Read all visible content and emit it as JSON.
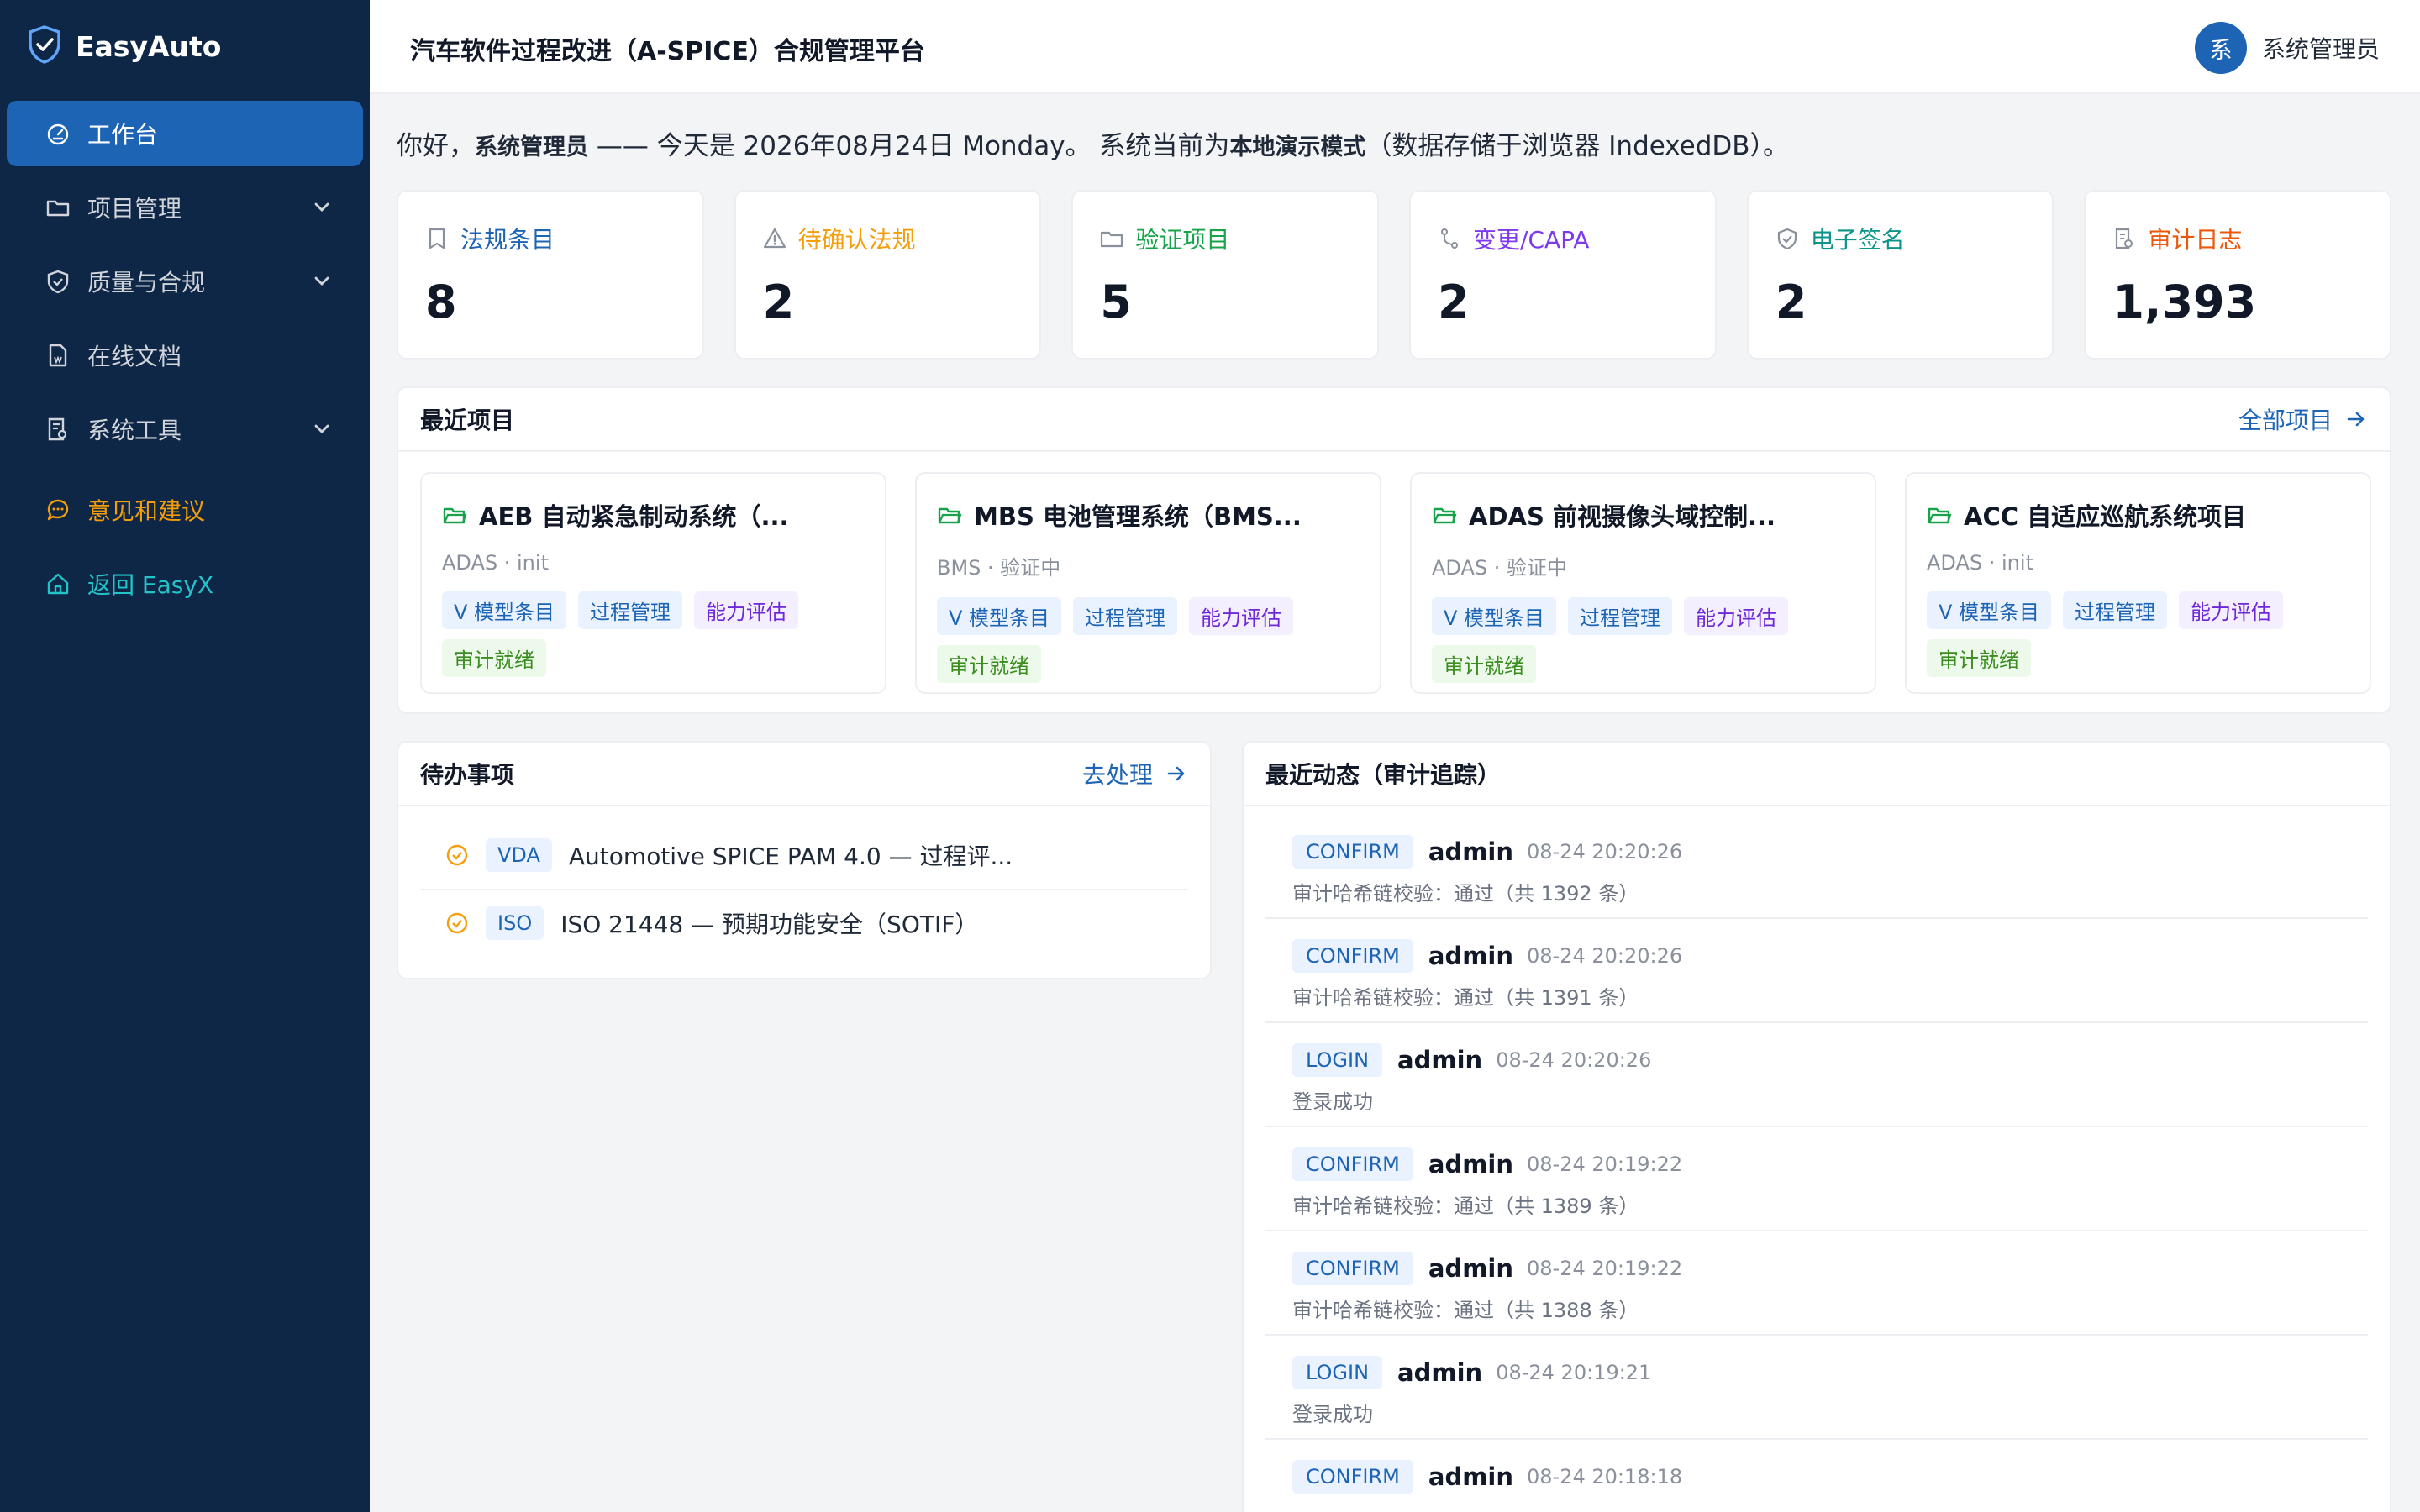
{
  "brand": {
    "name": "EasyAuto"
  },
  "sidebar": {
    "items": [
      {
        "label": "工作台",
        "icon": "dashboard-icon",
        "active": true
      },
      {
        "label": "项目管理",
        "icon": "folder-icon",
        "expandable": true
      },
      {
        "label": "质量与合规",
        "icon": "shield-icon",
        "expandable": true
      },
      {
        "label": "在线文档",
        "icon": "document-icon"
      },
      {
        "label": "系统工具",
        "icon": "tools-icon",
        "expandable": true
      }
    ],
    "feedback": {
      "label": "意见和建议",
      "icon": "chat-icon",
      "color": "#f59e0b"
    },
    "back": {
      "label": "返回 EasyX",
      "icon": "home-icon",
      "color": "#22c3c9"
    }
  },
  "header": {
    "title": "汽车软件过程改进（A-SPICE）合规管理平台",
    "avatar": "系",
    "username": "系统管理员"
  },
  "greeting": {
    "hello": "你好，",
    "user": "系统管理员",
    "mid": " —— 今天是 2026年08月24日 Monday。 系统当前为",
    "mode": "本地演示模式",
    "tail": "（数据存储于浏览器 IndexedDB）。"
  },
  "stats": [
    {
      "label": "法规条目",
      "value": "8",
      "color": "#1d64b5",
      "icon": "bookmark-icon"
    },
    {
      "label": "待确认法规",
      "value": "2",
      "color": "#f59e0b",
      "icon": "warning-icon"
    },
    {
      "label": "验证项目",
      "value": "5",
      "color": "#16a34a",
      "icon": "folder-icon"
    },
    {
      "label": "变更/CAPA",
      "value": "2",
      "color": "#7c3aed",
      "icon": "git-branch-icon"
    },
    {
      "label": "电子签名",
      "value": "2",
      "color": "#0d9488",
      "icon": "shield-check-icon"
    },
    {
      "label": "审计日志",
      "value": "1,393",
      "color": "#ea580c",
      "icon": "audit-icon"
    }
  ],
  "recent_projects": {
    "title": "最近项目",
    "link": "全部项目",
    "items": [
      {
        "name": "AEB 自动紧急制动系统（...",
        "sub": "ADAS · init",
        "tags": [
          "V 模型条目",
          "过程管理",
          "能力评估",
          "审计就绪"
        ]
      },
      {
        "name": "MBS 电池管理系统（BMS...",
        "sub": "BMS · 验证中",
        "tags": [
          "V 模型条目",
          "过程管理",
          "能力评估",
          "审计就绪"
        ]
      },
      {
        "name": "ADAS 前视摄像头域控制...",
        "sub": "ADAS · 验证中",
        "tags": [
          "V 模型条目",
          "过程管理",
          "能力评估",
          "审计就绪"
        ]
      },
      {
        "name": "ACC 自适应巡航系统项目",
        "sub": "ADAS · init",
        "tags": [
          "V 模型条目",
          "过程管理",
          "能力评估",
          "审计就绪"
        ]
      }
    ]
  },
  "todo": {
    "title": "待办事项",
    "link": "去处理",
    "items": [
      {
        "tag": "VDA",
        "text": "Automotive SPICE PAM 4.0 — 过程评..."
      },
      {
        "tag": "ISO",
        "text": "ISO 21448 — 预期功能安全（SOTIF）"
      }
    ]
  },
  "activity": {
    "title": "最近动态（审计追踪）",
    "items": [
      {
        "type": "CONFIRM",
        "user": "admin",
        "time": "08-24 20:20:26",
        "desc": "审计哈希链校验：通过（共 1392 条）"
      },
      {
        "type": "CONFIRM",
        "user": "admin",
        "time": "08-24 20:20:26",
        "desc": "审计哈希链校验：通过（共 1391 条）"
      },
      {
        "type": "LOGIN",
        "user": "admin",
        "time": "08-24 20:20:26",
        "desc": "登录成功"
      },
      {
        "type": "CONFIRM",
        "user": "admin",
        "time": "08-24 20:19:22",
        "desc": "审计哈希链校验：通过（共 1389 条）"
      },
      {
        "type": "CONFIRM",
        "user": "admin",
        "time": "08-24 20:19:22",
        "desc": "审计哈希链校验：通过（共 1388 条）"
      },
      {
        "type": "LOGIN",
        "user": "admin",
        "time": "08-24 20:19:21",
        "desc": "登录成功"
      },
      {
        "type": "CONFIRM",
        "user": "admin",
        "time": "08-24 20:18:18",
        "desc": ""
      }
    ]
  }
}
